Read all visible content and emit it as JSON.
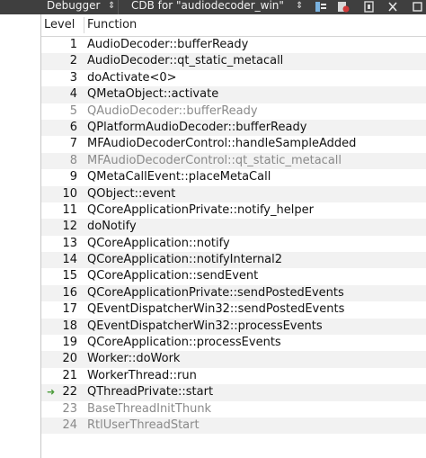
{
  "toolbar": {
    "engine_combo": "Debugger",
    "snapshot_combo": "CDB for \"audiodecoder_win\""
  },
  "stack": {
    "columns": {
      "level": "Level",
      "function": "Function"
    },
    "current_marker": "➜",
    "rows": [
      {
        "level": "1",
        "function": "AudioDecoder::bufferReady",
        "dim": false
      },
      {
        "level": "2",
        "function": "AudioDecoder::qt_static_metacall",
        "dim": false
      },
      {
        "level": "3",
        "function": "doActivate<0>",
        "dim": false
      },
      {
        "level": "4",
        "function": "QMetaObject::activate",
        "dim": false
      },
      {
        "level": "5",
        "function": "QAudioDecoder::bufferReady",
        "dim": true
      },
      {
        "level": "6",
        "function": "QPlatformAudioDecoder::bufferReady",
        "dim": false
      },
      {
        "level": "7",
        "function": "MFAudioDecoderControl::handleSampleAdded",
        "dim": false
      },
      {
        "level": "8",
        "function": "MFAudioDecoderControl::qt_static_metacall",
        "dim": true
      },
      {
        "level": "9",
        "function": "QMetaCallEvent::placeMetaCall",
        "dim": false
      },
      {
        "level": "10",
        "function": "QObject::event",
        "dim": false
      },
      {
        "level": "11",
        "function": "QCoreApplicationPrivate::notify_helper",
        "dim": false
      },
      {
        "level": "12",
        "function": "doNotify",
        "dim": false
      },
      {
        "level": "13",
        "function": "QCoreApplication::notify",
        "dim": false
      },
      {
        "level": "14",
        "function": "QCoreApplication::notifyInternal2",
        "dim": false
      },
      {
        "level": "15",
        "function": "QCoreApplication::sendEvent",
        "dim": false
      },
      {
        "level": "16",
        "function": "QCoreApplicationPrivate::sendPostedEvents",
        "dim": false
      },
      {
        "level": "17",
        "function": "QEventDispatcherWin32::sendPostedEvents",
        "dim": false
      },
      {
        "level": "18",
        "function": "QEventDispatcherWin32::processEvents",
        "dim": false
      },
      {
        "level": "19",
        "function": "QCoreApplication::processEvents",
        "dim": false
      },
      {
        "level": "20",
        "function": "Worker::doWork",
        "dim": false
      },
      {
        "level": "21",
        "function": "WorkerThread::run",
        "dim": false
      },
      {
        "level": "22",
        "function": "QThreadPrivate::start",
        "dim": false,
        "current": true
      },
      {
        "level": "23",
        "function": "BaseThreadInitThunk",
        "dim": true
      },
      {
        "level": "24",
        "function": "RtlUserThreadStart",
        "dim": true
      }
    ]
  },
  "icons": [
    "chevron-down-icon",
    "step-icon",
    "breakpoint-icon",
    "close-icon",
    "current-frame-arrow-icon"
  ],
  "colors": {
    "toolbar_bg": "#3f3f3f",
    "dim_text": "#8a8a8a",
    "current_marker": "#4b9c3a"
  }
}
